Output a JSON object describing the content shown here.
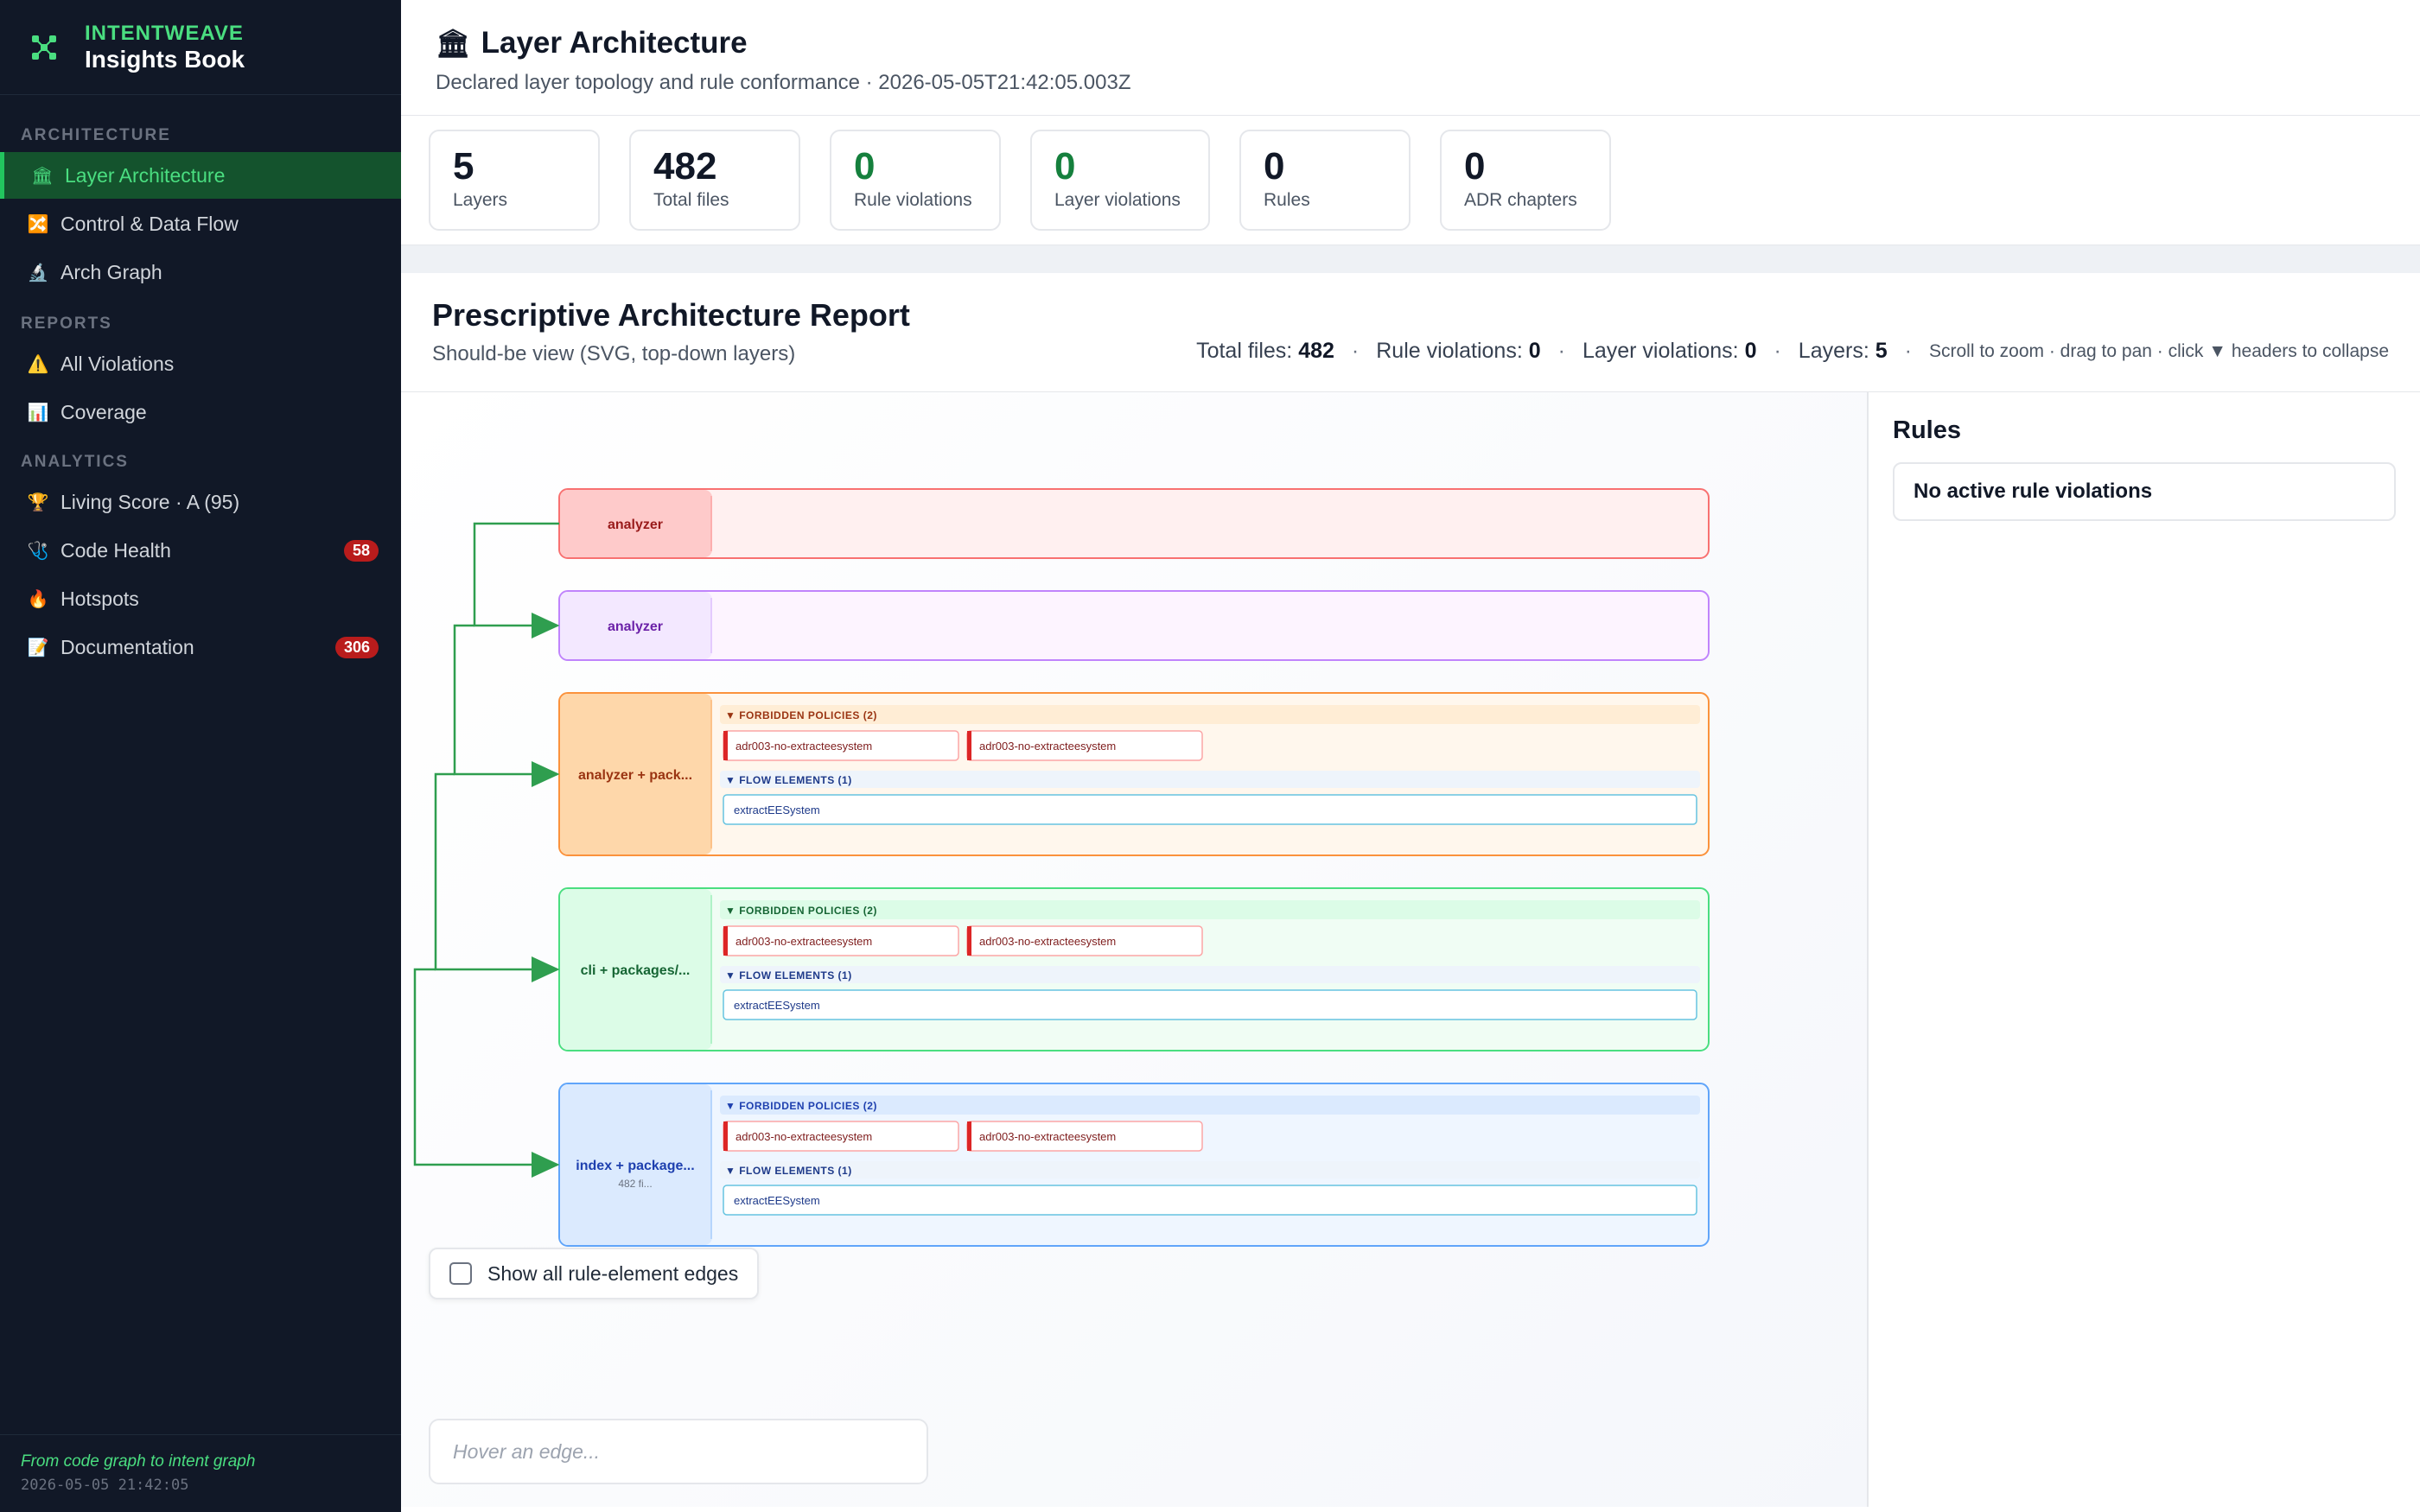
{
  "brand": {
    "line1": "INTENTWEAVE",
    "line2": "Insights Book"
  },
  "sidebar": {
    "sections": [
      {
        "label": "ARCHITECTURE"
      },
      {
        "label": "REPORTS"
      },
      {
        "label": "ANALYTICS"
      }
    ],
    "items": [
      {
        "label": "Layer Architecture",
        "icon": "bank-icon"
      },
      {
        "label": "Control & Data Flow",
        "icon": "flow-icon"
      },
      {
        "label": "Arch Graph",
        "icon": "microscope-icon"
      },
      {
        "label": "All Violations",
        "icon": "warning-icon"
      },
      {
        "label": "Coverage",
        "icon": "bar-chart-icon"
      },
      {
        "label": "Living Score · A (95)",
        "icon": "trophy-icon"
      },
      {
        "label": "Code Health",
        "icon": "stethoscope-icon",
        "badge": "58"
      },
      {
        "label": "Hotspots",
        "icon": "fire-icon"
      },
      {
        "label": "Documentation",
        "icon": "memo-icon",
        "badge": "306"
      }
    ],
    "footer": {
      "tagline": "From code graph to intent graph",
      "timestamp": "2026-05-05 21:42:05"
    }
  },
  "header": {
    "title": "Layer Architecture",
    "subtitle": "Declared layer topology and rule conformance · 2026-05-05T21:42:05.003Z"
  },
  "stats": [
    {
      "value": "5",
      "label": "Layers"
    },
    {
      "value": "482",
      "label": "Total files"
    },
    {
      "value": "0",
      "label": "Rule violations"
    },
    {
      "value": "0",
      "label": "Layer violations"
    },
    {
      "value": "0",
      "label": "Rules"
    },
    {
      "value": "0",
      "label": "ADR chapters"
    }
  ],
  "report": {
    "title": "Prescriptive Architecture Report",
    "subtitle": "Should-be view (SVG, top-down layers)",
    "meta": {
      "files_label": "Total files:",
      "files_value": "482",
      "rv_label": "Rule violations:",
      "rv_value": "0",
      "lv_label": "Layer violations:",
      "lv_value": "0",
      "layers_label": "Layers:",
      "layers_value": "5",
      "hint": "Scroll to zoom · drag to pan · click ▼ headers to collapse"
    },
    "checkbox_label": "Show all rule-element edges",
    "hover_placeholder": "Hover an edge...",
    "rules_title": "Rules",
    "rules_empty": "No active rule violations"
  },
  "colors": {
    "edge": "#2f9e4f",
    "layers": [
      "#f87171",
      "#c084fc",
      "#fb923c",
      "#4ade80",
      "#60a5fa"
    ]
  },
  "layers": [
    {
      "label": "analyzer",
      "sub": ""
    },
    {
      "label": "analyzer",
      "sub": ""
    },
    {
      "label": "analyzer + pack...",
      "sub": "",
      "policies_header": "▼ FORBIDDEN POLICIES (2)",
      "policies": [
        "adr003-no-extracteesystem",
        "adr003-no-extracteesystem"
      ],
      "flow_header": "▼ FLOW ELEMENTS (1)",
      "flow": [
        "extractEESystem"
      ]
    },
    {
      "label": "cli + packages/...",
      "sub": "",
      "policies_header": "▼ FORBIDDEN POLICIES (2)",
      "policies": [
        "adr003-no-extracteesystem",
        "adr003-no-extracteesystem"
      ],
      "flow_header": "▼ FLOW ELEMENTS (1)",
      "flow": [
        "extractEESystem"
      ]
    },
    {
      "label": "index + package...",
      "sub": "482 fi...",
      "policies_header": "▼ FORBIDDEN POLICIES (2)",
      "policies": [
        "adr003-no-extracteesystem",
        "adr003-no-extracteesystem"
      ],
      "flow_header": "▼ FLOW ELEMENTS (1)",
      "flow": [
        "extractEESystem"
      ]
    }
  ]
}
